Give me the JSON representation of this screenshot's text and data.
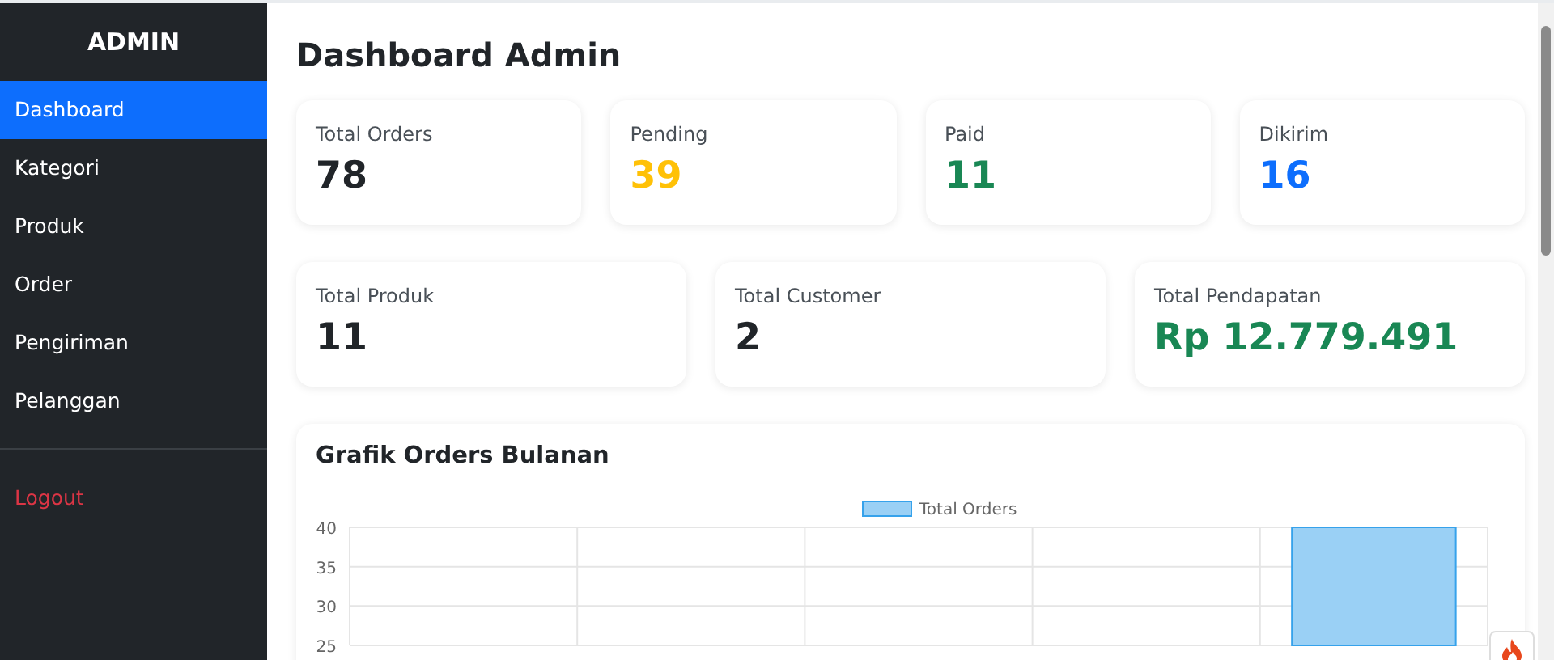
{
  "sidebar": {
    "title": "ADMIN",
    "items": [
      {
        "label": "Dashboard",
        "selected": true
      },
      {
        "label": "Kategori",
        "selected": false
      },
      {
        "label": "Produk",
        "selected": false
      },
      {
        "label": "Order",
        "selected": false
      },
      {
        "label": "Pengiriman",
        "selected": false
      },
      {
        "label": "Pelanggan",
        "selected": false
      }
    ],
    "logout": "Logout"
  },
  "page_title": "Dashboard Admin",
  "stats_row_1": [
    {
      "label": "Total Orders",
      "value": "78",
      "color": "#212529"
    },
    {
      "label": "Pending",
      "value": "39",
      "color": "#ffc107"
    },
    {
      "label": "Paid",
      "value": "11",
      "color": "#198754"
    },
    {
      "label": "Dikirim",
      "value": "16",
      "color": "#0d6efd"
    }
  ],
  "stats_row_2": [
    {
      "label": "Total Produk",
      "value": "11",
      "color": "#212529"
    },
    {
      "label": "Total Customer",
      "value": "2",
      "color": "#212529"
    },
    {
      "label": "Total Pendapatan",
      "value": "Rp 12.779.491",
      "color": "#198754"
    }
  ],
  "chart_card": {
    "title": "Grafik Orders Bulanan",
    "chart_data": {
      "type": "bar",
      "series": [
        {
          "name": "Total Orders",
          "color": "#9ad0f5",
          "values": [
            null,
            null,
            null,
            null,
            40
          ]
        }
      ],
      "ylim": [
        25,
        40
      ],
      "yticks": [
        25,
        30,
        35,
        40
      ]
    }
  }
}
